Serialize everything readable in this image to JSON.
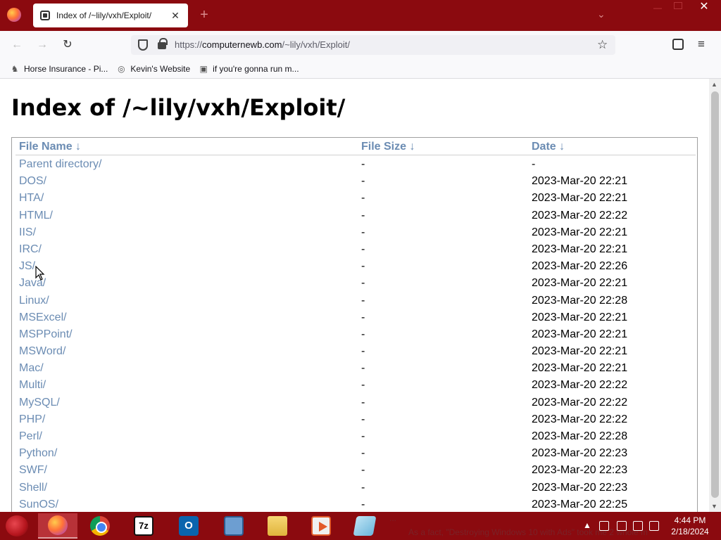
{
  "browser": {
    "tab_title": "Index of /~lily/vxh/Exploit/",
    "url_prefix": "https://",
    "url_host": "computernewb.com",
    "url_path": "/~lily/vxh/Exploit/",
    "new_tab": "+",
    "tab_close": "✕",
    "window_close": "✕"
  },
  "bookmarks": [
    {
      "label": "Horse Insurance - Pi...",
      "icon": "horse-icon"
    },
    {
      "label": "Kevin's Website",
      "icon": "globe-icon"
    },
    {
      "label": "if you're gonna run m...",
      "icon": "app-icon"
    }
  ],
  "page": {
    "title": "Index of /~lily/vxh/Exploit/",
    "columns": {
      "name": "File Name  ↓",
      "size": "File Size  ↓",
      "date": "Date  ↓"
    },
    "rows": [
      {
        "name": "Parent directory/",
        "size": "-",
        "date": "-"
      },
      {
        "name": "DOS/",
        "size": "-",
        "date": "2023-Mar-20 22:21"
      },
      {
        "name": "HTA/",
        "size": "-",
        "date": "2023-Mar-20 22:21"
      },
      {
        "name": "HTML/",
        "size": "-",
        "date": "2023-Mar-20 22:22"
      },
      {
        "name": "IIS/",
        "size": "-",
        "date": "2023-Mar-20 22:21"
      },
      {
        "name": "IRC/",
        "size": "-",
        "date": "2023-Mar-20 22:21"
      },
      {
        "name": "JS/",
        "size": "-",
        "date": "2023-Mar-20 22:26"
      },
      {
        "name": "Java/",
        "size": "-",
        "date": "2023-Mar-20 22:21"
      },
      {
        "name": "Linux/",
        "size": "-",
        "date": "2023-Mar-20 22:28"
      },
      {
        "name": "MSExcel/",
        "size": "-",
        "date": "2023-Mar-20 22:21"
      },
      {
        "name": "MSPPoint/",
        "size": "-",
        "date": "2023-Mar-20 22:21"
      },
      {
        "name": "MSWord/",
        "size": "-",
        "date": "2023-Mar-20 22:21"
      },
      {
        "name": "Mac/",
        "size": "-",
        "date": "2023-Mar-20 22:21"
      },
      {
        "name": "Multi/",
        "size": "-",
        "date": "2023-Mar-20 22:22"
      },
      {
        "name": "MySQL/",
        "size": "-",
        "date": "2023-Mar-20 22:22"
      },
      {
        "name": "PHP/",
        "size": "-",
        "date": "2023-Mar-20 22:22"
      },
      {
        "name": "Perl/",
        "size": "-",
        "date": "2023-Mar-20 22:28"
      },
      {
        "name": "Python/",
        "size": "-",
        "date": "2023-Mar-20 22:23"
      },
      {
        "name": "SWF/",
        "size": "-",
        "date": "2023-Mar-20 22:23"
      },
      {
        "name": "Shell/",
        "size": "-",
        "date": "2023-Mar-20 22:23"
      },
      {
        "name": "SunOS/",
        "size": "-",
        "date": "2023-Mar-20 22:25"
      }
    ]
  },
  "taskbar": {
    "apps": [
      "firefox-icon",
      "chrome-icon",
      "7zip-icon",
      "outlook-icon",
      "monitor-icon",
      "file-explorer-icon",
      "media-player-icon",
      "notepad-icon"
    ],
    "background_text_1": "...",
    "background_text_2": "As a fact, \"Destroying Windows 10 with Ads\" took me 2 whole m",
    "time": "4:44 PM",
    "date": "2/18/2024"
  },
  "colors": {
    "theme": "#8b0a0f",
    "link": "#6b8cb3"
  }
}
